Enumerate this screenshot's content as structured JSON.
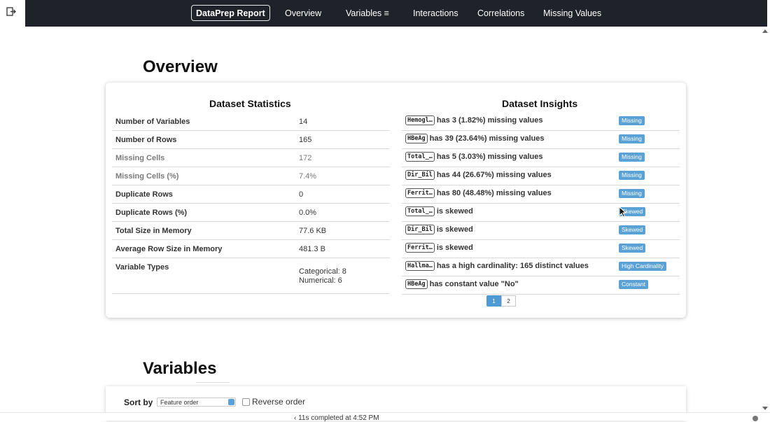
{
  "navbar": {
    "brand": "DataPrep Report",
    "links": [
      {
        "label": "Overview"
      },
      {
        "label": "Variables ≡"
      },
      {
        "label": "Interactions"
      },
      {
        "label": "Correlations"
      },
      {
        "label": "Missing Values"
      }
    ]
  },
  "overview": {
    "heading": "Overview",
    "stats_title": "Dataset Statistics",
    "stats": [
      {
        "label": "Number of Variables",
        "value": "14"
      },
      {
        "label": "Number of Rows",
        "value": "165"
      },
      {
        "label": "Missing Cells",
        "value": "172"
      },
      {
        "label": "Missing Cells (%)",
        "value": "7.4%"
      },
      {
        "label": "Duplicate Rows",
        "value": "0"
      },
      {
        "label": "Duplicate Rows (%)",
        "value": "0.0%"
      },
      {
        "label": "Total Size in Memory",
        "value": "77.6 KB"
      },
      {
        "label": "Average Row Size in Memory",
        "value": "481.3 B"
      },
      {
        "label": "Variable Types",
        "value_lines": [
          "Categorical: 8",
          "Numerical: 6"
        ]
      }
    ],
    "insights_title": "Dataset Insights",
    "insights": [
      {
        "code": "Hemogl…",
        "text": "has 3 (1.82%) missing values",
        "badge": "Missing"
      },
      {
        "code": "HBeAg",
        "text": "has 39 (23.64%) missing values",
        "badge": "Missing"
      },
      {
        "code": "Total_…",
        "text": "has 5 (3.03%) missing values",
        "badge": "Missing"
      },
      {
        "code": "Dir_Bil",
        "text": "has 44 (26.67%) missing values",
        "badge": "Missing"
      },
      {
        "code": "Ferrit…",
        "text": "has 80 (48.48%) missing values",
        "badge": "Missing"
      },
      {
        "code": "Total_…",
        "text": "is skewed",
        "badge": "Skewed"
      },
      {
        "code": "Dir_Bil",
        "text": "is skewed",
        "badge": "Skewed"
      },
      {
        "code": "Ferrit…",
        "text": "is skewed",
        "badge": "Skewed"
      },
      {
        "code": "Hallma…",
        "text": "has a high cardinality: 165 distinct values",
        "badge": "High Cardinality"
      },
      {
        "code": "HBeAg",
        "text": "has constant value \"No\"",
        "badge": "Constant"
      }
    ],
    "pagination": {
      "pages": [
        "1",
        "2"
      ],
      "current": "1"
    }
  },
  "variables": {
    "heading": "Variables",
    "sort_label": "Sort by",
    "sort_value": "Feature order",
    "reverse_label": "Reverse order"
  },
  "status_bar": {
    "text": "‹  11s      completed at 4:52 PM"
  },
  "colors": {
    "navbar_bg": "#1f2228",
    "badge_blue": "#5aa1d6",
    "page_active": "#4e9bd4"
  }
}
